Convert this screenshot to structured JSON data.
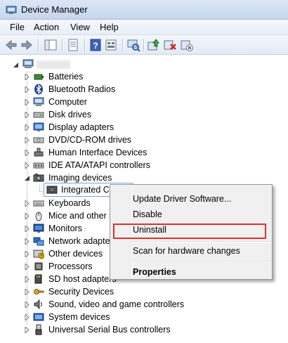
{
  "window": {
    "title": "Device Manager"
  },
  "menubar": {
    "items": [
      "File",
      "Action",
      "View",
      "Help"
    ]
  },
  "toolbar": {
    "buttons": [
      "back-arrow-icon",
      "forward-arrow-icon",
      "show-hide-console-tree-icon",
      "properties-icon",
      "help-icon",
      "refresh-view-icon",
      "scan-hardware-icon",
      "update-driver-icon",
      "uninstall-icon",
      "disable-icon"
    ]
  },
  "tree": {
    "root": "",
    "categories": [
      "Batteries",
      "Bluetooth Radios",
      "Computer",
      "Disk drives",
      "Display adapters",
      "DVD/CD-ROM drives",
      "Human Interface Devices",
      "IDE ATA/ATAPI controllers",
      "Imaging devices",
      "Keyboards",
      "Mice and other p",
      "Monitors",
      "Network adapte",
      "Other devices",
      "Processors",
      "SD host adapters",
      "Security Devices",
      "Sound, video and game controllers",
      "System devices",
      "Universal Serial Bus controllers"
    ],
    "expanded_child": "Integrated C"
  },
  "context_menu": {
    "update": "Update Driver Software...",
    "disable": "Disable",
    "uninstall": "Uninstall",
    "scan": "Scan for hardware changes",
    "properties": "Properties"
  },
  "colors": {
    "highlight_border": "#e0312f",
    "titlebar": "#c4d6ee"
  }
}
